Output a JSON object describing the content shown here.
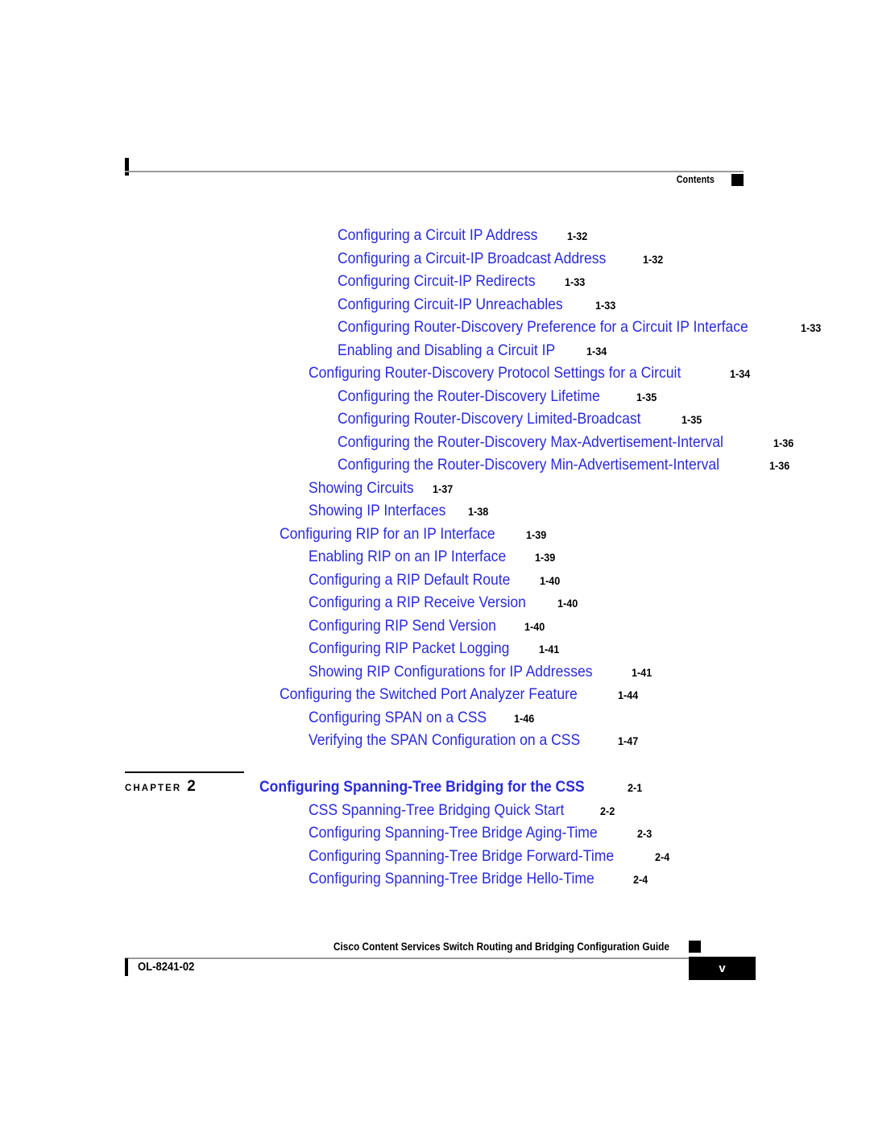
{
  "header": {
    "label": "Contents",
    "square_color": "#000000"
  },
  "colors": {
    "link_blue": "#2b2bdd",
    "page_number_black": "#000000",
    "rule_gray": "#9a9a9a"
  },
  "toc": {
    "entries": [
      {
        "level": 2,
        "title": "Configuring a Circuit IP Address",
        "page": "1-32"
      },
      {
        "level": 2,
        "title": "Configuring a Circuit-IP Broadcast Address",
        "page": "1-32"
      },
      {
        "level": 2,
        "title": "Configuring Circuit-IP Redirects",
        "page": "1-33"
      },
      {
        "level": 2,
        "title": "Configuring Circuit-IP Unreachables",
        "page": "1-33"
      },
      {
        "level": 2,
        "title": "Configuring Router-Discovery Preference for a Circuit IP Interface",
        "page": "1-33"
      },
      {
        "level": 2,
        "title": "Enabling and Disabling a Circuit IP",
        "page": "1-34"
      },
      {
        "level": 1,
        "title": "Configuring Router-Discovery Protocol Settings for a Circuit",
        "page": "1-34"
      },
      {
        "level": 2,
        "title": "Configuring the Router-Discovery Lifetime",
        "page": "1-35"
      },
      {
        "level": 2,
        "title": "Configuring Router-Discovery Limited-Broadcast",
        "page": "1-35"
      },
      {
        "level": 2,
        "title": "Configuring the Router-Discovery Max-Advertisement-Interval",
        "page": "1-36"
      },
      {
        "level": 2,
        "title": "Configuring the Router-Discovery Min-Advertisement-Interval",
        "page": "1-36"
      },
      {
        "level": 1,
        "title": "Showing Circuits",
        "page": "1-37"
      },
      {
        "level": 1,
        "title": "Showing IP Interfaces",
        "page": "1-38"
      },
      {
        "level": 0,
        "title": "Configuring RIP for an IP Interface",
        "page": "1-39"
      },
      {
        "level": 1,
        "title": "Enabling RIP on an IP Interface",
        "page": "1-39"
      },
      {
        "level": 1,
        "title": "Configuring a RIP Default Route",
        "page": "1-40"
      },
      {
        "level": 1,
        "title": "Configuring a RIP Receive Version",
        "page": "1-40"
      },
      {
        "level": 1,
        "title": "Configuring RIP Send Version",
        "page": "1-40"
      },
      {
        "level": 1,
        "title": "Configuring RIP Packet Logging",
        "page": "1-41"
      },
      {
        "level": 1,
        "title": "Showing RIP Configurations for IP Addresses",
        "page": "1-41"
      },
      {
        "level": 0,
        "title": "Configuring the Switched Port Analyzer Feature",
        "page": "1-44"
      },
      {
        "level": 1,
        "title": "Configuring SPAN on a CSS",
        "page": "1-46"
      },
      {
        "level": 1,
        "title": "Verifying the SPAN Configuration on a CSS",
        "page": "1-47"
      }
    ]
  },
  "chapter": {
    "label": "CHAPTER",
    "number": "2",
    "title": "Configuring Spanning-Tree Bridging for the CSS",
    "page": "2-1",
    "entries": [
      {
        "level": 1,
        "title": "CSS Spanning-Tree Bridging Quick Start",
        "page": "2-2"
      },
      {
        "level": 1,
        "title": "Configuring Spanning-Tree Bridge Aging-Time",
        "page": "2-3"
      },
      {
        "level": 1,
        "title": "Configuring Spanning-Tree Bridge Forward-Time",
        "page": "2-4"
      },
      {
        "level": 1,
        "title": "Configuring Spanning-Tree Bridge Hello-Time",
        "page": "2-4"
      }
    ]
  },
  "footer": {
    "guide_title": "Cisco Content Services Switch Routing and Bridging Configuration Guide",
    "document_id": "OL-8241-02",
    "page_number": "v"
  }
}
